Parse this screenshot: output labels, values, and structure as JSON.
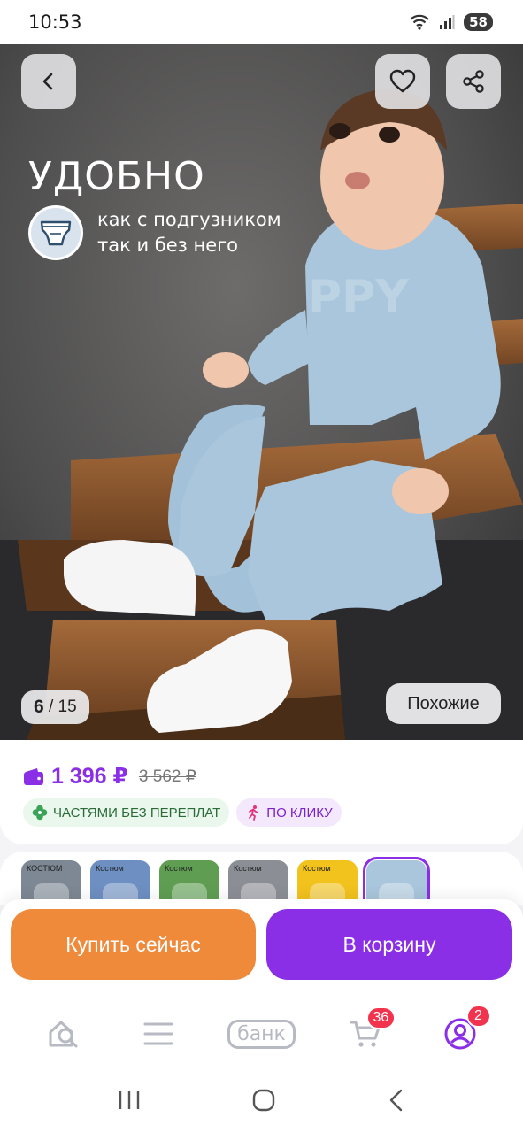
{
  "status_bar": {
    "time": "10:53",
    "battery": "58",
    "icons": [
      "wifi-icon",
      "signal-icon",
      "battery-icon"
    ]
  },
  "hero": {
    "icons": [
      "back-arrow-icon",
      "heart-icon",
      "share-icon",
      "diaper-icon"
    ],
    "title": "УДОБНО",
    "subtitle_line1": "как с подгузником",
    "subtitle_line2": "так и без него",
    "shirt_text": "PPY",
    "counter_current": "6",
    "counter_sep": " / ",
    "counter_total": "15",
    "similar_label": "Похожие"
  },
  "price": {
    "current": "1 396 ₽",
    "old": "3 562 ₽",
    "wallet_icon": "wallet-icon",
    "badge_installments": "ЧАСТЯМИ БЕЗ ПЕРЕПЛАТ",
    "badge_one_click": "ПО КЛИКУ",
    "badge_icons": [
      "clover-icon",
      "running-person-icon"
    ]
  },
  "thumbnails": {
    "items": [
      {
        "label": "КОСТЮМ",
        "color": "#7d8894"
      },
      {
        "label": "Костюм",
        "color": "#6e8fc2"
      },
      {
        "label": "Костюм",
        "color": "#5f9e52"
      },
      {
        "label": "Костюм",
        "color": "#8c8e96"
      },
      {
        "label": "Костюм",
        "color": "#f2c21d"
      },
      {
        "label": "",
        "color": "#a9c6dc"
      }
    ],
    "selected_index": 5
  },
  "actions": {
    "buy_now": "Купить сейчас",
    "add_to_cart": "В корзину"
  },
  "bottom_nav": {
    "icons": [
      "home-search-icon",
      "catalog-menu-icon",
      "bank-icon",
      "cart-icon",
      "profile-icon"
    ],
    "bank_label": "банк",
    "cart_count": "36",
    "profile_count": "2"
  },
  "system_nav": {
    "icons": [
      "recent-apps-icon",
      "home-icon",
      "back-icon"
    ]
  },
  "colors": {
    "accent_purple": "#8b2fe6",
    "accent_orange": "#f08a3b",
    "badge_red": "#f2334e"
  }
}
